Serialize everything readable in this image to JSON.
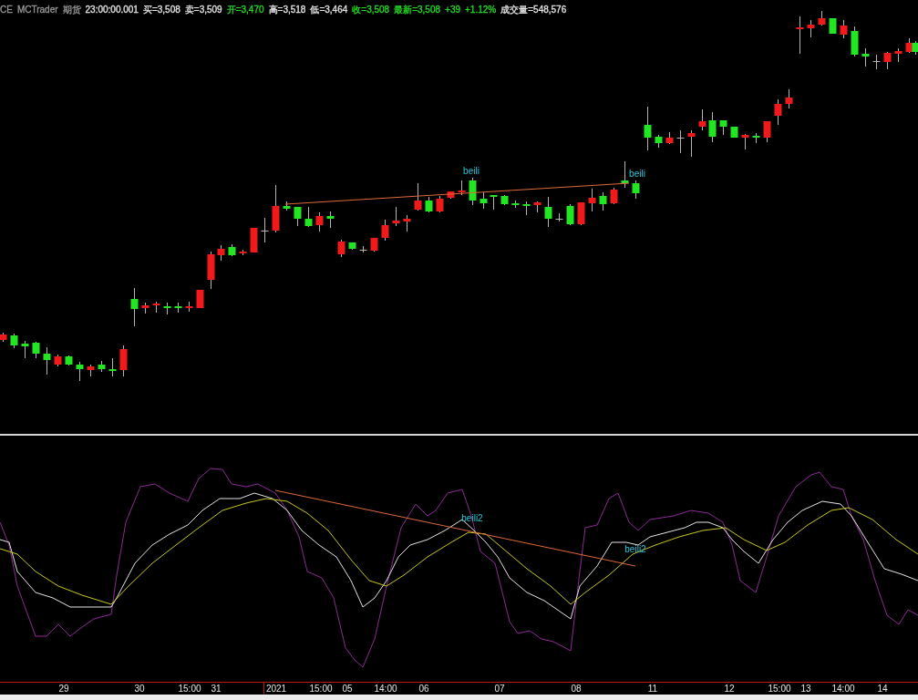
{
  "quote_bar": [
    {
      "text": "CE",
      "color": "#9a9a9a"
    },
    {
      "text": "MCTrader",
      "color": "#9a9a9a"
    },
    {
      "text": "期货",
      "color": "#9a9a9a"
    },
    {
      "text": "23:00:00.001",
      "color": "#e6e6e6"
    },
    {
      "text": "买=3,508",
      "color": "#e6e6e6"
    },
    {
      "text": "卖=3,509",
      "color": "#e6e6e6"
    },
    {
      "text": "开=3,470",
      "color": "#22dd22"
    },
    {
      "text": "高=3,518",
      "color": "#e6e6e6"
    },
    {
      "text": "低=3,464",
      "color": "#e6e6e6"
    },
    {
      "text": "收=3,508",
      "color": "#22dd22"
    },
    {
      "text": "最新=3,508",
      "color": "#22dd22"
    },
    {
      "text": "+39",
      "color": "#22dd22"
    },
    {
      "text": "+1.12%",
      "color": "#22dd22"
    },
    {
      "text": "成交量=548,576",
      "color": "#e6e6e6"
    }
  ],
  "price_chart": {
    "labels": [
      "beili",
      "beili"
    ]
  },
  "indicator_chart": {
    "labels": [
      "beili2",
      "beili2"
    ]
  },
  "time_axis": {
    "labels": [
      "29",
      "30",
      "15:00",
      "31",
      "2021",
      "15:00",
      "05",
      "14:00",
      "06",
      "07",
      "08",
      "11",
      "12",
      "15:00",
      "13",
      "14:00",
      "14"
    ]
  }
}
